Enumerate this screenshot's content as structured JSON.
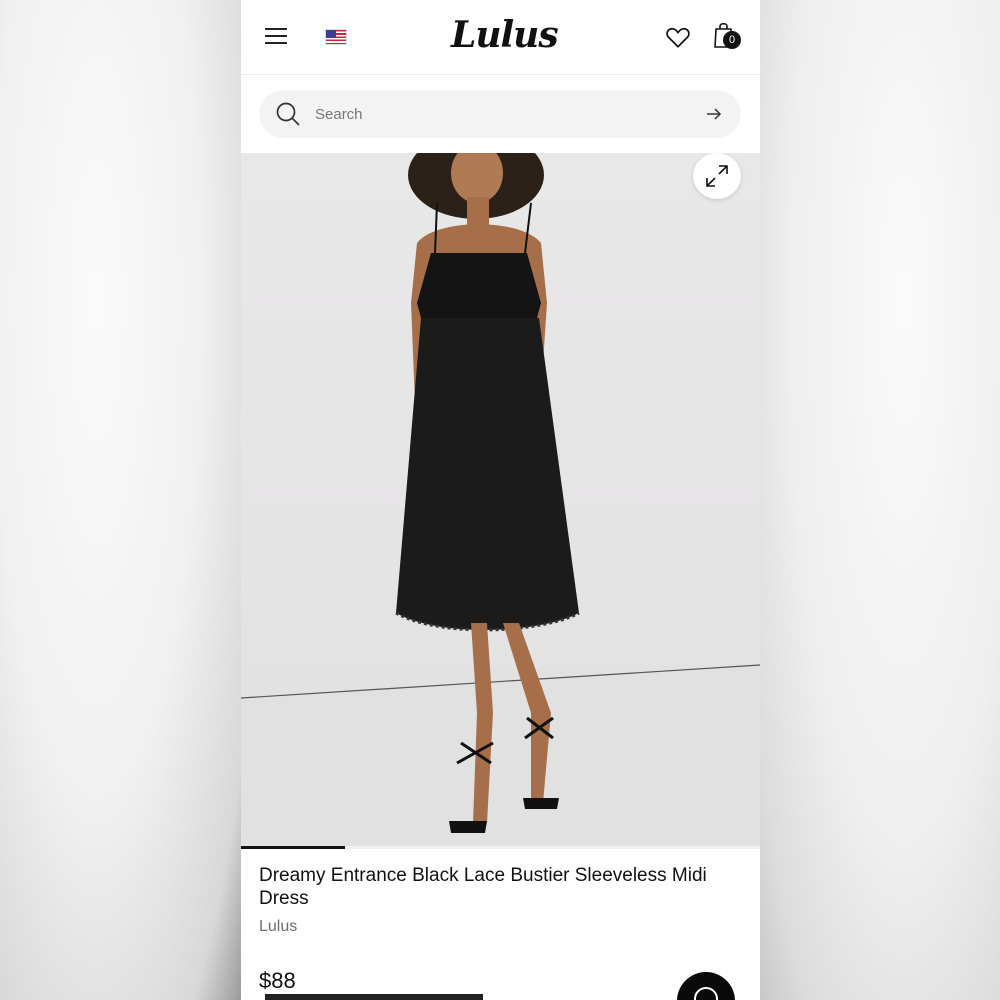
{
  "header": {
    "brand_logo_text": "Lulus",
    "cart_count": "0",
    "country_flag": "us-flag-icon"
  },
  "search": {
    "placeholder": "Search"
  },
  "gallery": {
    "image_description_icon": "product-photo",
    "progress_fraction": 0.2
  },
  "product": {
    "title": "Dreamy Entrance Black Lace Bustier Sleeveless Midi Dress",
    "brand": "Lulus",
    "price": "$88"
  },
  "colors": {
    "accent": "#111111",
    "search_bg": "#f3f3f3",
    "brand_text": "#6e6e6e"
  }
}
